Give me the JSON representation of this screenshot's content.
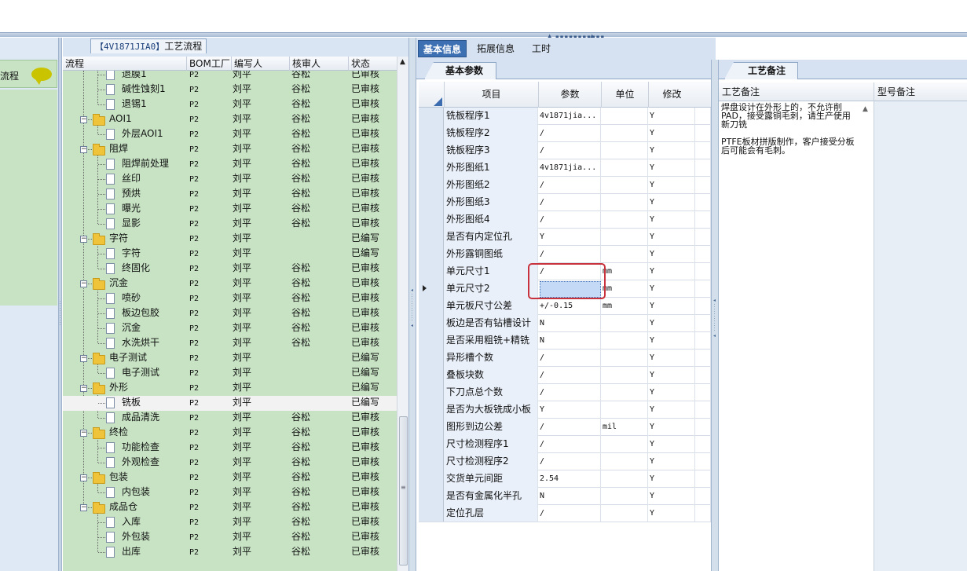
{
  "top_bar": {
    "grip": "▪▪▪▪▪▪▪▪▪▪▪",
    "arrow_left": "▲",
    "arrow_right": "▲"
  },
  "left_panel": {
    "item_label": "流程"
  },
  "tree": {
    "title_tag": "【4V1871JIA0】",
    "title_text": "工艺流程",
    "columns": [
      "流程",
      "BOM工厂",
      "编写人",
      "核审人",
      "状态"
    ],
    "rows": [
      {
        "name": "退膜1",
        "level": 2,
        "type": "doc",
        "bom": "P2",
        "writer": "刘平",
        "reviewer": "谷松",
        "status": "已审核"
      },
      {
        "name": "碱性蚀刻1",
        "level": 2,
        "type": "doc",
        "bom": "P2",
        "writer": "刘平",
        "reviewer": "谷松",
        "status": "已审核"
      },
      {
        "name": "退锡1",
        "level": 2,
        "type": "doc",
        "bom": "P2",
        "writer": "刘平",
        "reviewer": "谷松",
        "status": "已审核"
      },
      {
        "name": "AOI1",
        "level": 1,
        "type": "folder",
        "bom": "P2",
        "writer": "刘平",
        "reviewer": "谷松",
        "status": "已审核"
      },
      {
        "name": "外层AOI1",
        "level": 2,
        "type": "doc",
        "bom": "P2",
        "writer": "刘平",
        "reviewer": "谷松",
        "status": "已审核"
      },
      {
        "name": "阻焊",
        "level": 1,
        "type": "folder",
        "bom": "P2",
        "writer": "刘平",
        "reviewer": "谷松",
        "status": "已审核"
      },
      {
        "name": "阻焊前处理",
        "level": 2,
        "type": "doc",
        "bom": "P2",
        "writer": "刘平",
        "reviewer": "谷松",
        "status": "已审核"
      },
      {
        "name": "丝印",
        "level": 2,
        "type": "doc",
        "bom": "P2",
        "writer": "刘平",
        "reviewer": "谷松",
        "status": "已审核"
      },
      {
        "name": "预烘",
        "level": 2,
        "type": "doc",
        "bom": "P2",
        "writer": "刘平",
        "reviewer": "谷松",
        "status": "已审核"
      },
      {
        "name": "曝光",
        "level": 2,
        "type": "doc",
        "bom": "P2",
        "writer": "刘平",
        "reviewer": "谷松",
        "status": "已审核"
      },
      {
        "name": "显影",
        "level": 2,
        "type": "doc",
        "bom": "P2",
        "writer": "刘平",
        "reviewer": "谷松",
        "status": "已审核"
      },
      {
        "name": "字符",
        "level": 1,
        "type": "folder",
        "bom": "P2",
        "writer": "刘平",
        "reviewer": "",
        "status": "已编写"
      },
      {
        "name": "字符",
        "level": 2,
        "type": "doc",
        "bom": "P2",
        "writer": "刘平",
        "reviewer": "",
        "status": "已编写"
      },
      {
        "name": "终固化",
        "level": 2,
        "type": "doc",
        "bom": "P2",
        "writer": "刘平",
        "reviewer": "谷松",
        "status": "已审核"
      },
      {
        "name": "沉金",
        "level": 1,
        "type": "folder",
        "bom": "P2",
        "writer": "刘平",
        "reviewer": "谷松",
        "status": "已审核"
      },
      {
        "name": "喷砂",
        "level": 2,
        "type": "doc",
        "bom": "P2",
        "writer": "刘平",
        "reviewer": "谷松",
        "status": "已审核"
      },
      {
        "name": "板边包胶",
        "level": 2,
        "type": "doc",
        "bom": "P2",
        "writer": "刘平",
        "reviewer": "谷松",
        "status": "已审核"
      },
      {
        "name": "沉金",
        "level": 2,
        "type": "doc",
        "bom": "P2",
        "writer": "刘平",
        "reviewer": "谷松",
        "status": "已审核"
      },
      {
        "name": "水洗烘干",
        "level": 2,
        "type": "doc",
        "bom": "P2",
        "writer": "刘平",
        "reviewer": "谷松",
        "status": "已审核"
      },
      {
        "name": "电子测试",
        "level": 1,
        "type": "folder",
        "bom": "P2",
        "writer": "刘平",
        "reviewer": "",
        "status": "已编写"
      },
      {
        "name": "电子测试",
        "level": 2,
        "type": "doc",
        "bom": "P2",
        "writer": "刘平",
        "reviewer": "",
        "status": "已编写"
      },
      {
        "name": "外形",
        "level": 1,
        "type": "folder",
        "bom": "P2",
        "writer": "刘平",
        "reviewer": "",
        "status": "已编写"
      },
      {
        "name": "铣板",
        "level": 2,
        "type": "doc",
        "bom": "P2",
        "writer": "刘平",
        "reviewer": "",
        "status": "已编写",
        "selected": true
      },
      {
        "name": "成品清洗",
        "level": 2,
        "type": "doc",
        "bom": "P2",
        "writer": "刘平",
        "reviewer": "谷松",
        "status": "已审核"
      },
      {
        "name": "终检",
        "level": 1,
        "type": "folder",
        "bom": "P2",
        "writer": "刘平",
        "reviewer": "谷松",
        "status": "已审核"
      },
      {
        "name": "功能检查",
        "level": 2,
        "type": "doc",
        "bom": "P2",
        "writer": "刘平",
        "reviewer": "谷松",
        "status": "已审核"
      },
      {
        "name": "外观检查",
        "level": 2,
        "type": "doc",
        "bom": "P2",
        "writer": "刘平",
        "reviewer": "谷松",
        "status": "已审核"
      },
      {
        "name": "包装",
        "level": 1,
        "type": "folder",
        "bom": "P2",
        "writer": "刘平",
        "reviewer": "谷松",
        "status": "已审核"
      },
      {
        "name": "内包装",
        "level": 2,
        "type": "doc",
        "bom": "P2",
        "writer": "刘平",
        "reviewer": "谷松",
        "status": "已审核"
      },
      {
        "name": "成品仓",
        "level": 1,
        "type": "folder",
        "bom": "P2",
        "writer": "刘平",
        "reviewer": "谷松",
        "status": "已审核"
      },
      {
        "name": "入库",
        "level": 2,
        "type": "doc",
        "bom": "P2",
        "writer": "刘平",
        "reviewer": "谷松",
        "status": "已审核"
      },
      {
        "name": "外包装",
        "level": 2,
        "type": "doc",
        "bom": "P2",
        "writer": "刘平",
        "reviewer": "谷松",
        "status": "已审核"
      },
      {
        "name": "出库",
        "level": 2,
        "type": "doc",
        "bom": "P2",
        "writer": "刘平",
        "reviewer": "谷松",
        "status": "已审核"
      }
    ],
    "scroll_up": "▲",
    "thumb_grip": "≡"
  },
  "params": {
    "tabs": [
      "基本信息",
      "拓展信息",
      "工时"
    ],
    "active_tab": 0,
    "sub_tab": "基本参数",
    "columns": [
      "项目",
      "参数",
      "单位",
      "修改"
    ],
    "current_row": 10,
    "rows": [
      {
        "item": "铣板程序1",
        "param": "4v1871jia...",
        "unit": "",
        "mod": "Y"
      },
      {
        "item": "铣板程序2",
        "param": "/",
        "unit": "",
        "mod": "Y"
      },
      {
        "item": "铣板程序3",
        "param": "/",
        "unit": "",
        "mod": "Y"
      },
      {
        "item": "外形图纸1",
        "param": "4v1871jia...",
        "unit": "",
        "mod": "Y"
      },
      {
        "item": "外形图纸2",
        "param": "/",
        "unit": "",
        "mod": "Y"
      },
      {
        "item": "外形图纸3",
        "param": "/",
        "unit": "",
        "mod": "Y"
      },
      {
        "item": "外形图纸4",
        "param": "/",
        "unit": "",
        "mod": "Y"
      },
      {
        "item": "是否有内定位孔",
        "param": "Y",
        "unit": "",
        "mod": "Y"
      },
      {
        "item": "外形露铜图纸",
        "param": "/",
        "unit": "",
        "mod": "Y"
      },
      {
        "item": "单元尺寸1",
        "param": "/",
        "unit": "mm",
        "mod": "Y"
      },
      {
        "item": "单元尺寸2",
        "param": "/",
        "unit": "mm",
        "mod": "Y"
      },
      {
        "item": "单元板尺寸公差",
        "param": "+/-0.15",
        "unit": "mm",
        "mod": "Y"
      },
      {
        "item": "板边是否有钻槽设计",
        "param": "N",
        "unit": "",
        "mod": "Y"
      },
      {
        "item": "是否采用粗铣+精铣",
        "param": "N",
        "unit": "",
        "mod": "Y"
      },
      {
        "item": "异形槽个数",
        "param": "/",
        "unit": "",
        "mod": "Y"
      },
      {
        "item": "叠板块数",
        "param": "/",
        "unit": "",
        "mod": "Y"
      },
      {
        "item": "下刀点总个数",
        "param": "/",
        "unit": "",
        "mod": "Y"
      },
      {
        "item": "是否为大板铣成小板",
        "param": "Y",
        "unit": "",
        "mod": "Y"
      },
      {
        "item": "图形到边公差",
        "param": "/",
        "unit": "mil",
        "mod": "Y"
      },
      {
        "item": "尺寸检测程序1",
        "param": "/",
        "unit": "",
        "mod": "Y"
      },
      {
        "item": "尺寸检测程序2",
        "param": "/",
        "unit": "",
        "mod": "Y"
      },
      {
        "item": "交货单元间距",
        "param": "2.54",
        "unit": "",
        "mod": "Y"
      },
      {
        "item": "是否有金属化半孔",
        "param": "N",
        "unit": "",
        "mod": "Y"
      },
      {
        "item": "定位孔层",
        "param": "/",
        "unit": "",
        "mod": "Y"
      }
    ]
  },
  "notes": {
    "tab": "工艺备注",
    "columns": [
      "工艺备注",
      "型号备注"
    ],
    "text": "焊盘设计在外形上的，不允许削PAD，接受露铜毛刺，请生产使用新刀铣\n\nPTFE板材拼版制作，客户接受分板后可能会有毛刺。",
    "scroll_up": "▲"
  },
  "colors": {
    "tree_bg": "#c7e3c4",
    "active_tab": "#3d6fb3",
    "highlight": "#c8323c"
  }
}
